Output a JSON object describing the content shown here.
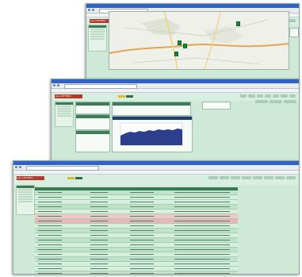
{
  "windows": [
    {
      "id": "map-window",
      "title": "ALL LETTERS"
    },
    {
      "id": "chart-window",
      "title": "ALL LETTERS"
    },
    {
      "id": "table-window",
      "title": "ALL LETTERS"
    }
  ],
  "colors": {
    "accent": "#3a7a52",
    "page_bg": "#cfe9d8",
    "titlebar": "#2f63c8",
    "highlight_row": "#f2c7c7",
    "active_tab": "#e1b832",
    "logo": "#b13a2b"
  },
  "map": {
    "pins": 4
  },
  "table": {
    "row_states": [
      "normal",
      "alt",
      "alt",
      "normal",
      "alt",
      "red",
      "pink",
      "alt",
      "normal",
      "alt",
      "normal",
      "alt",
      "normal",
      "alt",
      "normal",
      "alt",
      "alt",
      "normal",
      "alt",
      "normal"
    ]
  }
}
